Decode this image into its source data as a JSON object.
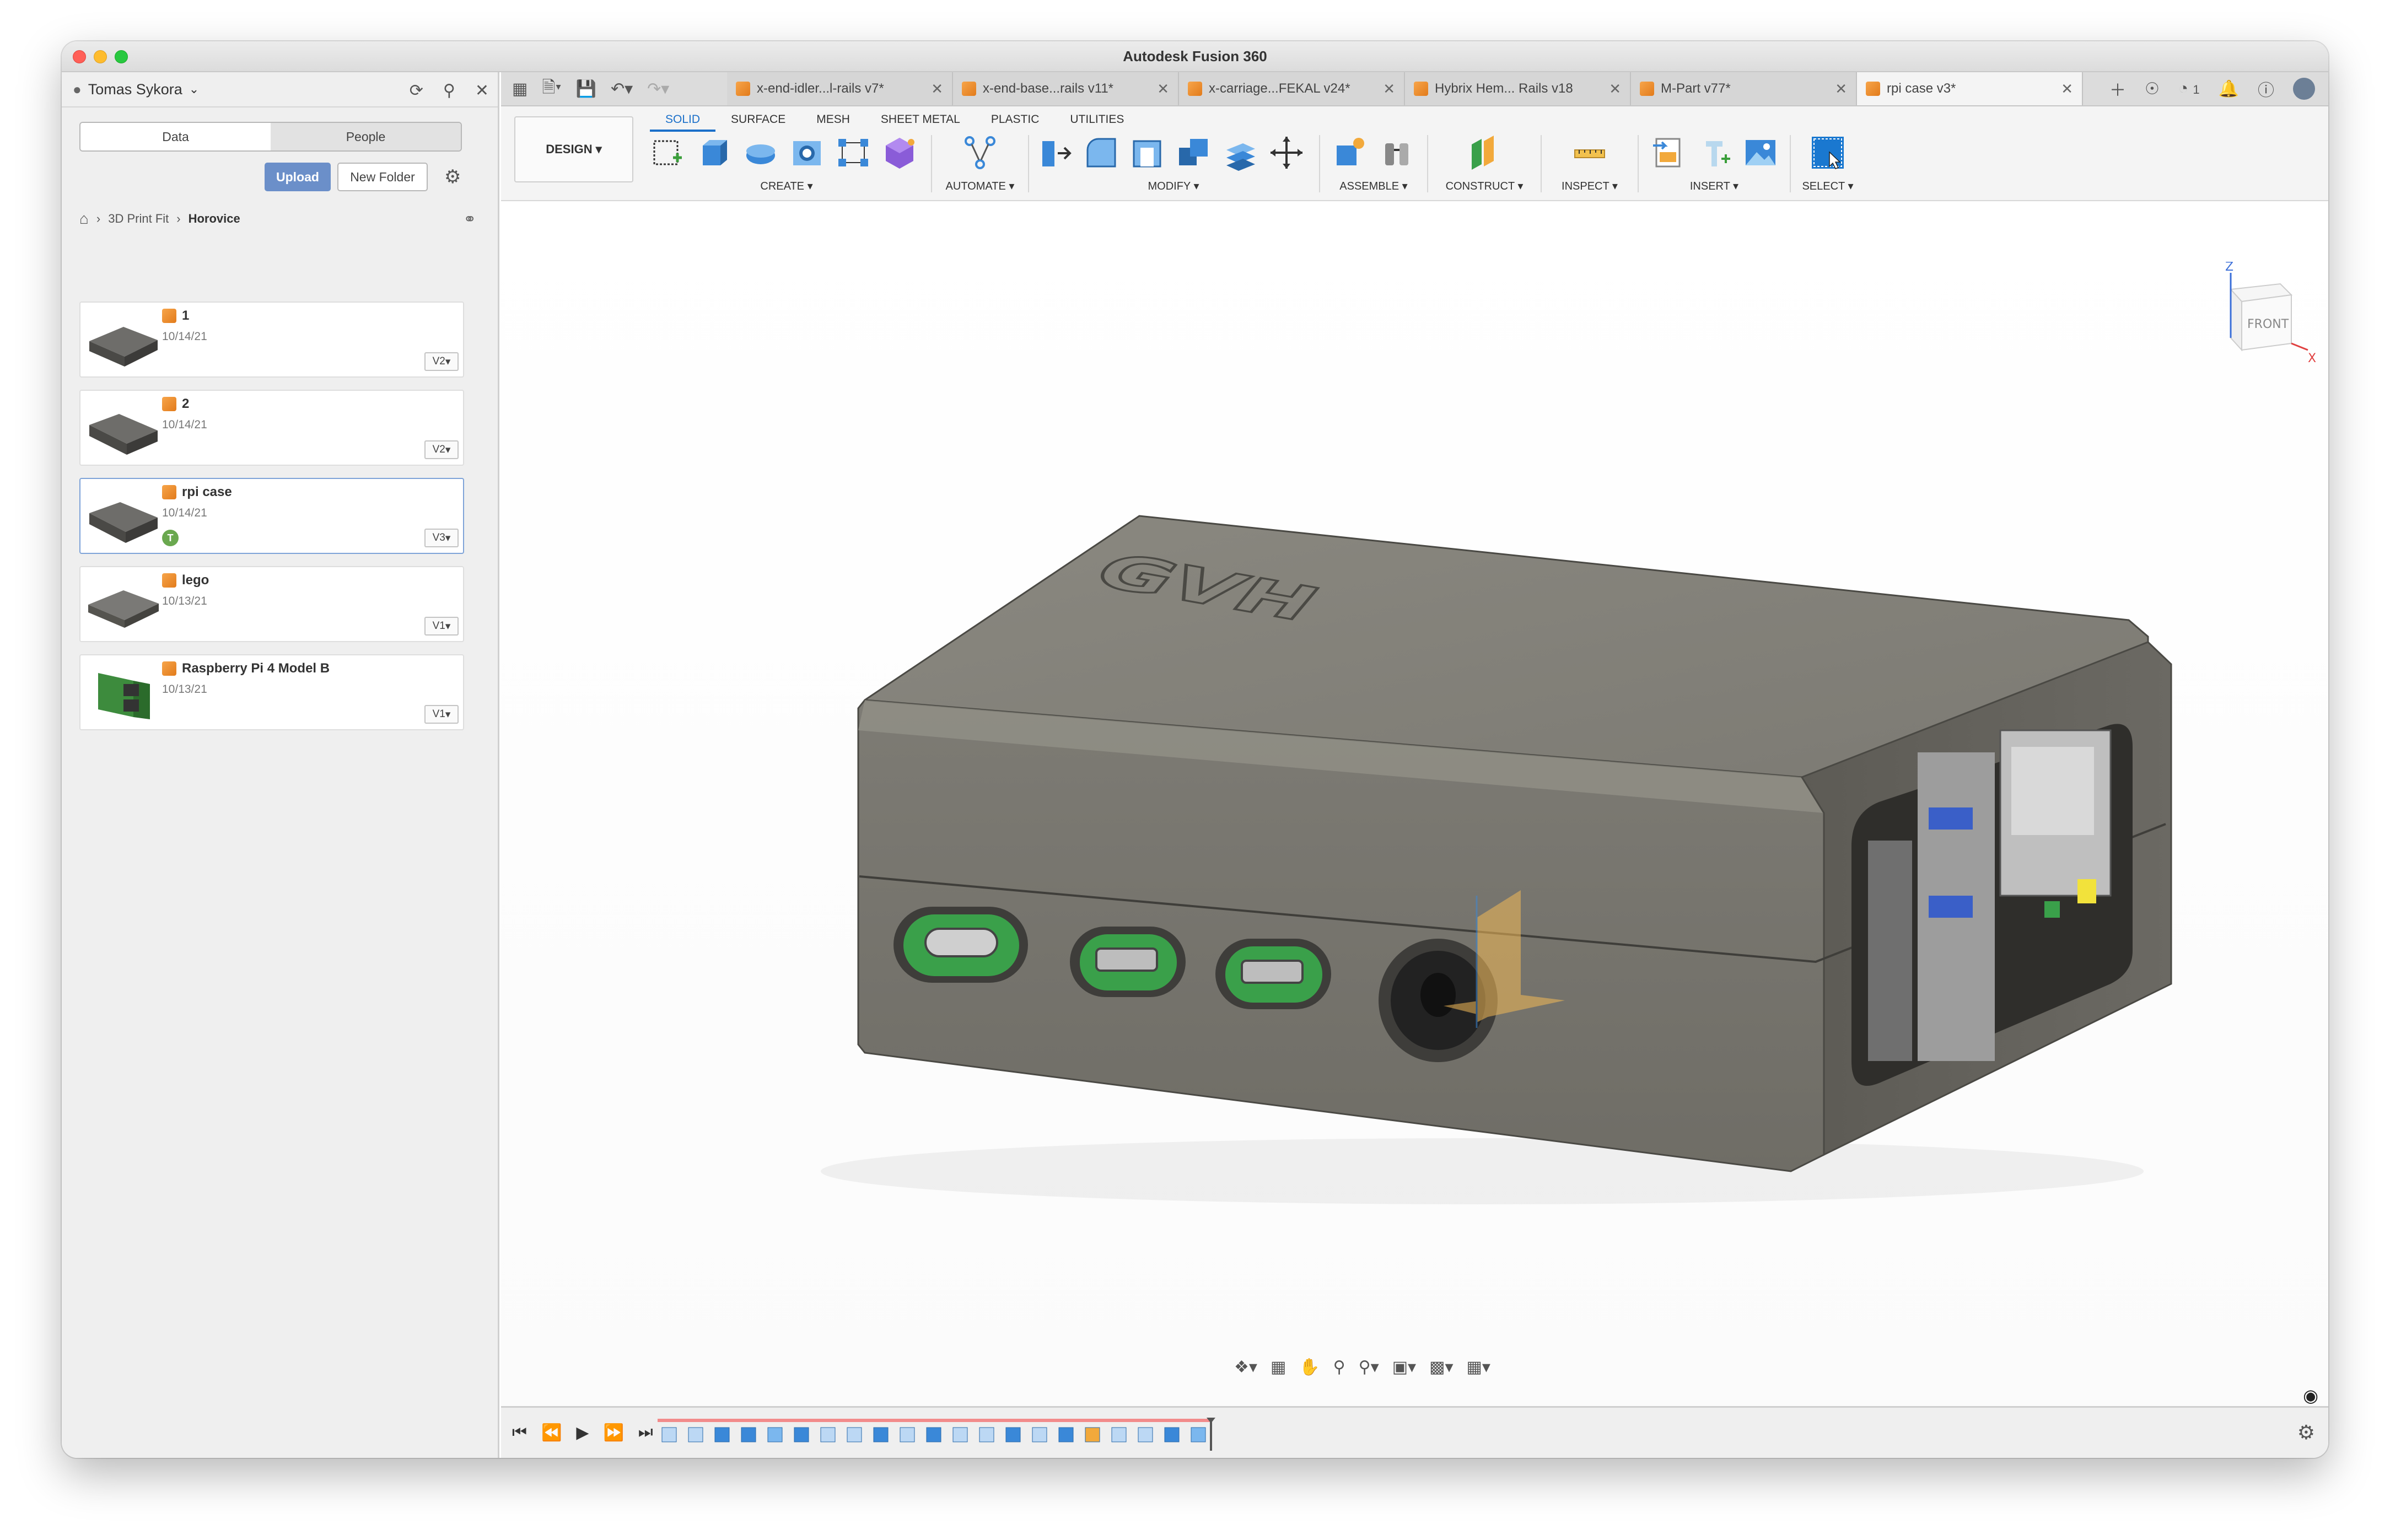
{
  "window": {
    "title": "Autodesk Fusion 360"
  },
  "data_panel": {
    "user": "Tomas Sykora",
    "tabs": [
      "Data",
      "People"
    ],
    "upload_label": "Upload",
    "new_folder_label": "New Folder",
    "breadcrumb": [
      "3D Print Fit",
      "Horovice"
    ],
    "items": [
      {
        "name": "1",
        "date": "10/14/21",
        "version": "V2"
      },
      {
        "name": "2",
        "date": "10/14/21",
        "version": "V2"
      },
      {
        "name": "rpi case",
        "date": "10/14/21",
        "version": "V3",
        "badge": "T"
      },
      {
        "name": "lego",
        "date": "10/13/21",
        "version": "V1"
      },
      {
        "name": "Raspberry Pi 4 Model B",
        "date": "10/13/21",
        "version": "V1"
      }
    ]
  },
  "doc_tabs": [
    {
      "label": "x-end-idler...l-rails v7*"
    },
    {
      "label": "x-end-base...rails v11*"
    },
    {
      "label": "x-carriage...FEKAL v24*"
    },
    {
      "label": "Hybrix Hem... Rails v18"
    },
    {
      "label": "M-Part v77*"
    },
    {
      "label": "rpi case v3*"
    }
  ],
  "tab_bar_right": {
    "job_count": "1"
  },
  "toolbar": {
    "workspace": "DESIGN",
    "workspace_tabs": [
      "SOLID",
      "SURFACE",
      "MESH",
      "SHEET METAL",
      "PLASTIC",
      "UTILITIES"
    ],
    "groups": [
      "CREATE",
      "AUTOMATE",
      "MODIFY",
      "ASSEMBLE",
      "CONSTRUCT",
      "INSPECT",
      "INSERT",
      "SELECT"
    ]
  },
  "viewport": {
    "model_engraving": "GVH",
    "viewcube": {
      "face": "FRONT",
      "axis_z": "Z",
      "axis_x": "X"
    }
  }
}
